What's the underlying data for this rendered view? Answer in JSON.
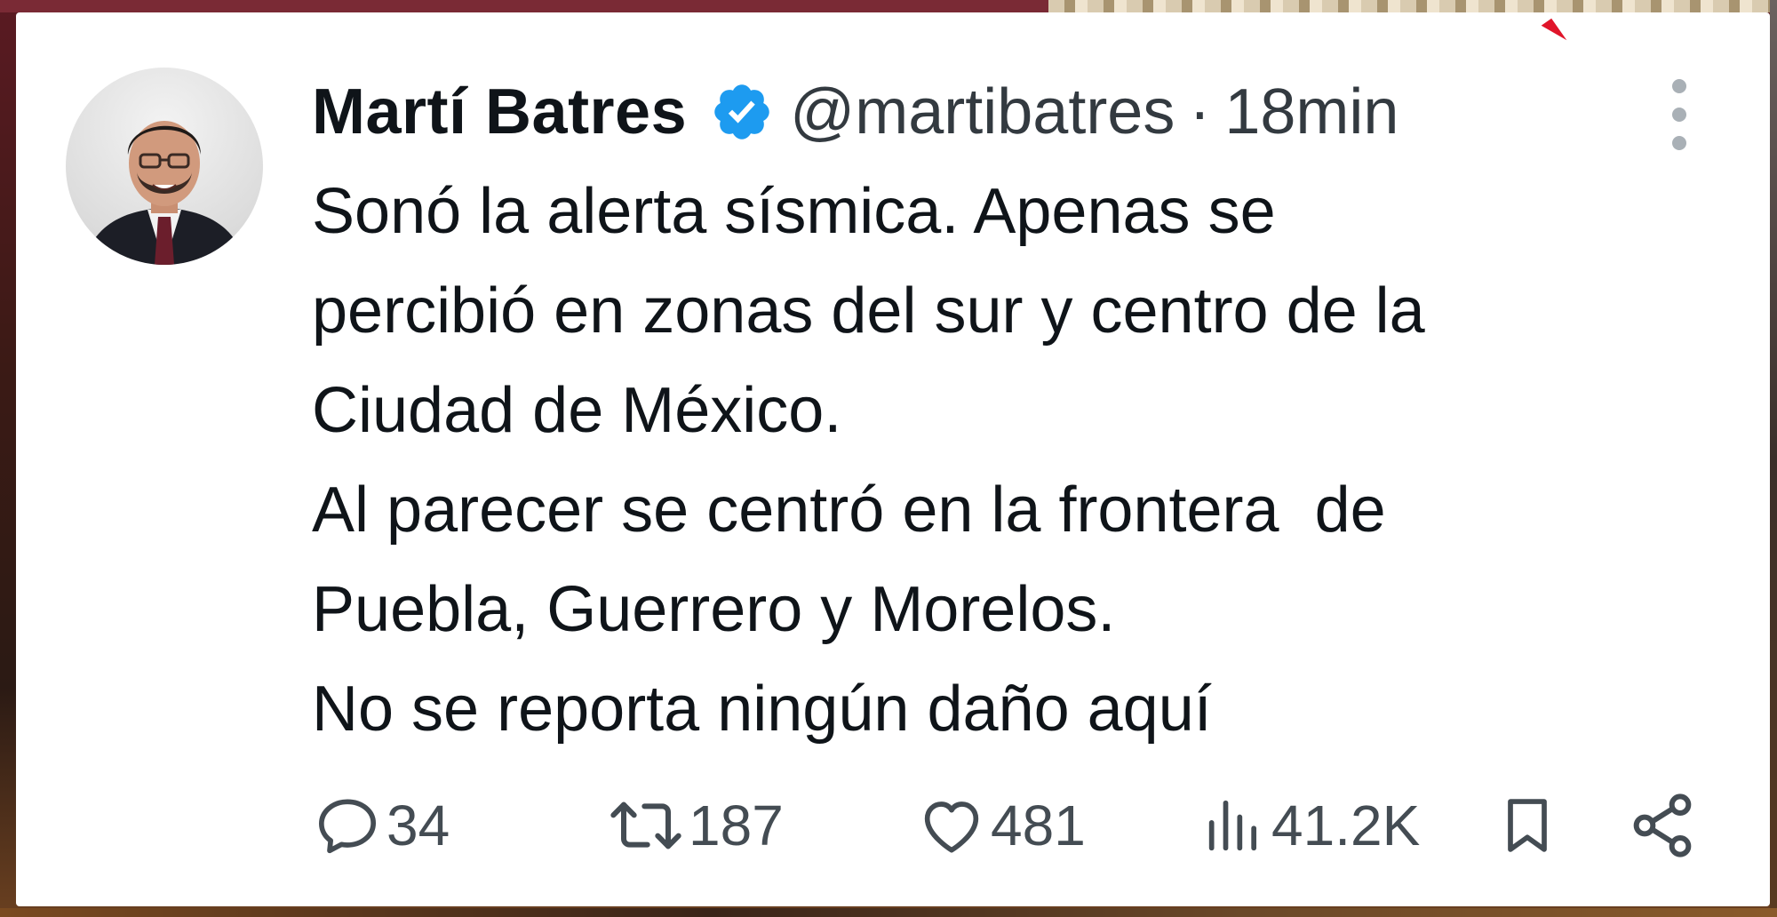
{
  "author": {
    "name": "Martí Batres",
    "verified_icon": "verified-badge-icon",
    "handle": "@martibatres",
    "separator": "·",
    "time": "18min"
  },
  "tweet": {
    "lines": [
      "Sonó la alerta sísmica. Apenas se",
      "percibió en zonas del sur y centro de la",
      "Ciudad de México.",
      "Al parecer se centró en la frontera  de",
      "Puebla, Guerrero y Morelos.",
      "No se reporta ningún daño aquí"
    ]
  },
  "actions": {
    "replies": "34",
    "retweets": "187",
    "likes": "481",
    "views": "41.2K"
  },
  "colors": {
    "verified": "#1d9bf0",
    "text": "#0f1419",
    "secondary": "#444c53"
  }
}
